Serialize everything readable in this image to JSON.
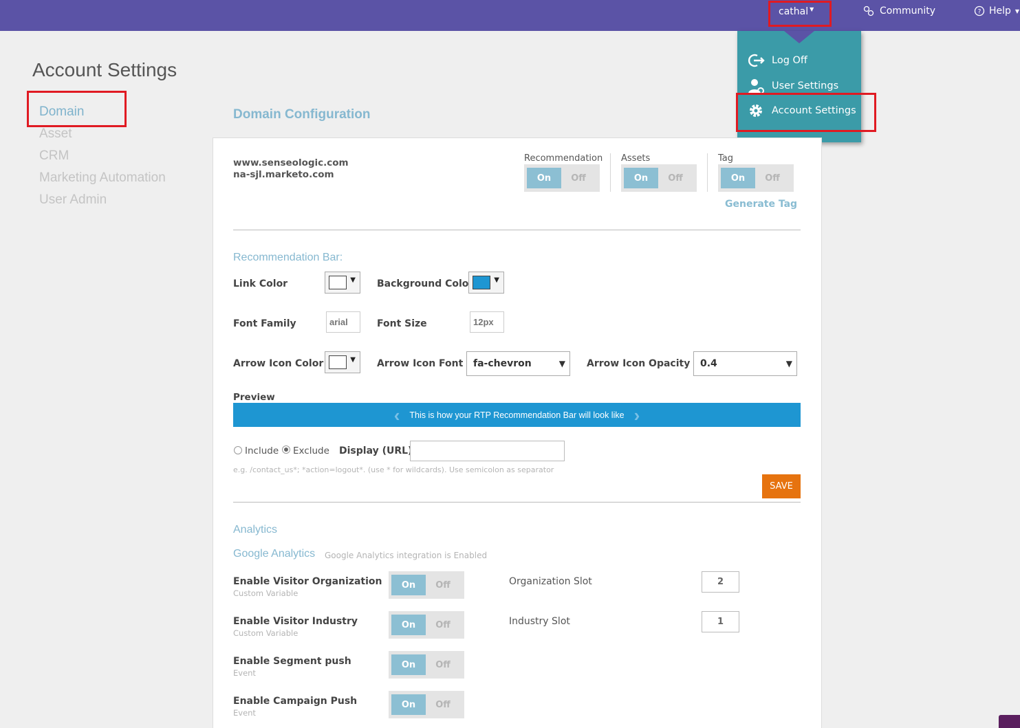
{
  "topbar": {
    "user": "cathal",
    "community": "Community",
    "help": "Help"
  },
  "user_menu": {
    "items": [
      {
        "label": "Log Off",
        "icon": "log-off-icon"
      },
      {
        "label": "User Settings",
        "icon": "user-settings-icon"
      },
      {
        "label": "Account Settings",
        "icon": "gear-icon"
      }
    ]
  },
  "page": {
    "title": "Account Settings",
    "section_title": "Domain Configuration"
  },
  "sidebar": {
    "items": [
      {
        "label": "Domain",
        "active": true
      },
      {
        "label": "Asset",
        "active": false
      },
      {
        "label": "CRM",
        "active": false
      },
      {
        "label": "Marketing Automation",
        "active": false
      },
      {
        "label": "User Admin",
        "active": false
      }
    ]
  },
  "domain": {
    "lines": [
      "www.senseologic.com",
      "na-sjl.marketo.com"
    ],
    "toggles": [
      {
        "label": "Recommendation",
        "on": "On",
        "off": "Off",
        "value": "On"
      },
      {
        "label": "Assets",
        "on": "On",
        "off": "Off",
        "value": "On"
      },
      {
        "label": "Tag",
        "on": "On",
        "off": "Off",
        "value": "On"
      }
    ],
    "generate_tag": "Generate Tag"
  },
  "recommendation_bar": {
    "heading": "Recommendation Bar:",
    "link_color_label": "Link Color",
    "link_color": "#ffffff",
    "background_color_label": "Background Color",
    "background_color": "#1e96d2",
    "font_family_label": "Font Family",
    "font_family_placeholder": "arial",
    "font_size_label": "Font Size",
    "font_size_placeholder": "12px",
    "arrow_icon_color_label": "Arrow Icon Color",
    "arrow_icon_color": "#ffffff",
    "arrow_icon_font_label": "Arrow Icon Font",
    "arrow_icon_font_value": "fa-chevron",
    "arrow_icon_opacity_label": "Arrow Icon Opacity",
    "arrow_icon_opacity_value": "0.4",
    "preview_label": "Preview",
    "preview_text": "This is how your RTP Recommendation Bar will look like",
    "include_label": "Include",
    "exclude_label": "Exclude",
    "selected_mode": "Exclude",
    "display_url_label": "Display (URL)",
    "display_url_value": "",
    "hint": "e.g. /contact_us*; *action=logout*. (use * for wildcards). Use semicolon as separator",
    "save_label": "SAVE"
  },
  "analytics": {
    "heading": "Analytics",
    "ga_title": "Google Analytics",
    "ga_status": "Google Analytics integration is Enabled",
    "rows": [
      {
        "label": "Enable Visitor Organization",
        "sub": "Custom Variable",
        "on": "On",
        "off": "Off",
        "value": "On"
      },
      {
        "label": "Enable Visitor Industry",
        "sub": "Custom Variable",
        "on": "On",
        "off": "Off",
        "value": "On"
      },
      {
        "label": "Enable Segment push",
        "sub": "Event",
        "on": "On",
        "off": "Off",
        "value": "On"
      },
      {
        "label": "Enable Campaign Push",
        "sub": "Event",
        "on": "On",
        "off": "Off",
        "value": "On"
      }
    ],
    "slots": [
      {
        "label": "Organization Slot",
        "value": "2"
      },
      {
        "label": "Industry Slot",
        "value": "1"
      }
    ]
  },
  "colors": {
    "topbar": "#5b53a6",
    "menu": "#3b9ba8",
    "accent": "#86b8d0",
    "save": "#e6730f",
    "highlight": "#e01a22"
  }
}
